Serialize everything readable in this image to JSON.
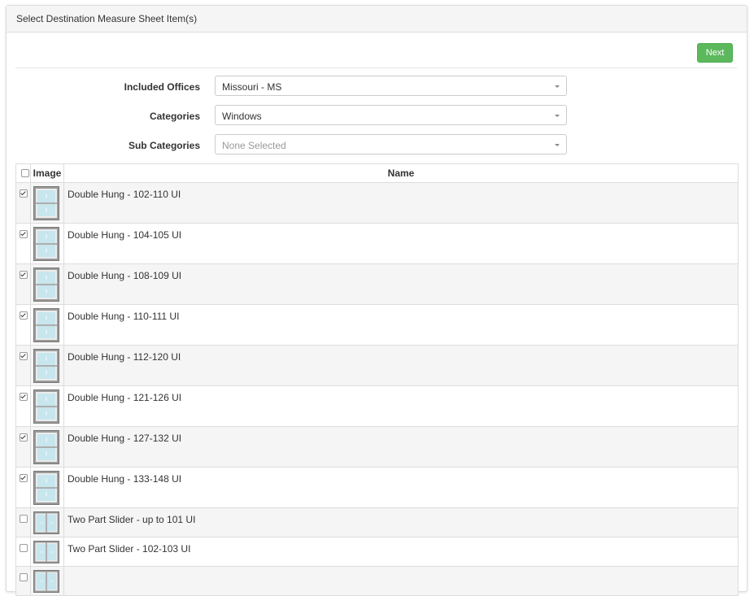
{
  "panel": {
    "title": "Select Destination Measure Sheet Item(s)"
  },
  "toolbar": {
    "next_label": "Next"
  },
  "filters": {
    "offices": {
      "label": "Included Offices",
      "value": "Missouri - MS"
    },
    "categories": {
      "label": "Categories",
      "value": "Windows"
    },
    "subcategories": {
      "label": "Sub Categories",
      "placeholder": "None Selected"
    }
  },
  "table": {
    "headers": {
      "image": "Image",
      "name": "Name"
    },
    "rows": [
      {
        "name": "Double Hung - 102-110 UI",
        "checked": true,
        "thumb": "double-hung-window-icon"
      },
      {
        "name": "Double Hung - 104-105 UI",
        "checked": true,
        "thumb": "double-hung-window-icon"
      },
      {
        "name": "Double Hung - 108-109 UI",
        "checked": true,
        "thumb": "double-hung-window-icon"
      },
      {
        "name": "Double Hung - 110-111 UI",
        "checked": true,
        "thumb": "double-hung-window-icon"
      },
      {
        "name": "Double Hung - 112-120 UI",
        "checked": true,
        "thumb": "double-hung-window-icon"
      },
      {
        "name": "Double Hung - 121-126 UI",
        "checked": true,
        "thumb": "double-hung-window-icon"
      },
      {
        "name": "Double Hung - 127-132 UI",
        "checked": true,
        "thumb": "double-hung-window-icon"
      },
      {
        "name": "Double Hung - 133-148 UI",
        "checked": true,
        "thumb": "double-hung-window-icon"
      },
      {
        "name": "Two Part Slider - up to 101 UI",
        "checked": false,
        "thumb": "slider-window-icon"
      },
      {
        "name": "Two Part Slider - 102-103 UI",
        "checked": false,
        "thumb": "slider-window-icon"
      },
      {
        "name": "",
        "checked": false,
        "thumb": "slider-window-icon"
      }
    ]
  },
  "colors": {
    "accent": "#5cb85c",
    "stripe": "#f5f5f5",
    "glass": "#c7e6ee"
  }
}
